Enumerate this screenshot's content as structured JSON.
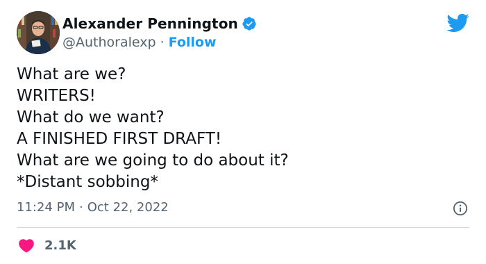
{
  "author": {
    "name": "Alexander Pennington",
    "handle": "@Authoralexp",
    "separator": "·",
    "follow_label": "Follow"
  },
  "tweet": {
    "lines": [
      "What are we?",
      "WRITERS!",
      "What do we want?",
      "A FINISHED FIRST DRAFT!",
      "What are we going to do about it?",
      "*Distant sobbing*"
    ],
    "time": "11:24 PM",
    "separator": "·",
    "date": "Oct 22, 2022"
  },
  "engagement": {
    "like_count": "2.1K"
  },
  "colors": {
    "accent": "#1d9bf0",
    "heart": "#f91880",
    "secondary_text": "#536471"
  },
  "icons": {
    "verified": "verified-badge-icon",
    "brand": "twitter-bird-icon",
    "info": "info-icon",
    "like": "heart-icon"
  }
}
